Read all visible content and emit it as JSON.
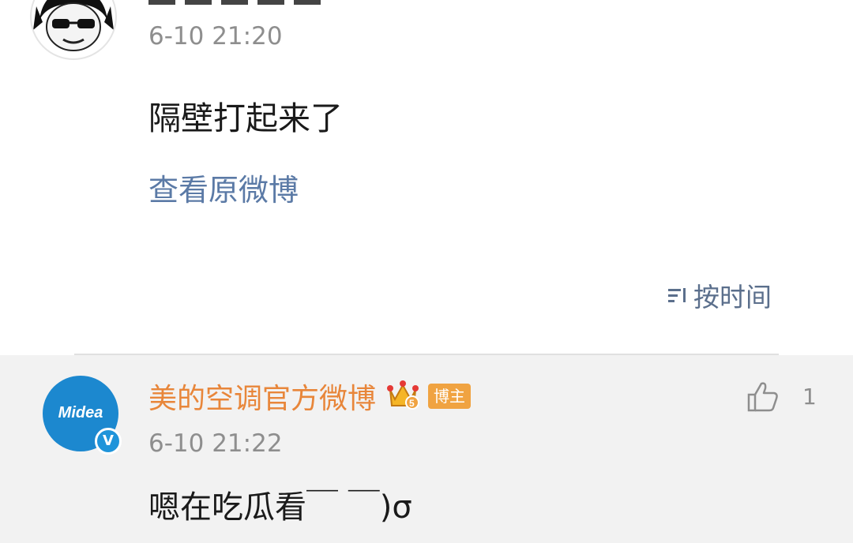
{
  "first_comment": {
    "time": "6-10 21:20",
    "text": "隔壁打起来了",
    "link_label": "查看原微博"
  },
  "sort": {
    "label": "按时间",
    "icon": "sort-lines-icon"
  },
  "reply": {
    "avatar_text": "Midea",
    "verified_badge": "V",
    "name": "美的空调官方微博",
    "tag": "博主",
    "time": "6-10 21:22",
    "text": "嗯在吃瓜看￣ ￣)σ",
    "like_count": "1"
  },
  "colors": {
    "link": "#5b7aa6",
    "name_orange": "#e8863a",
    "tag_bg": "#f0a341",
    "midea_blue": "#1c88cf",
    "reply_bg": "#f2f2f2"
  }
}
